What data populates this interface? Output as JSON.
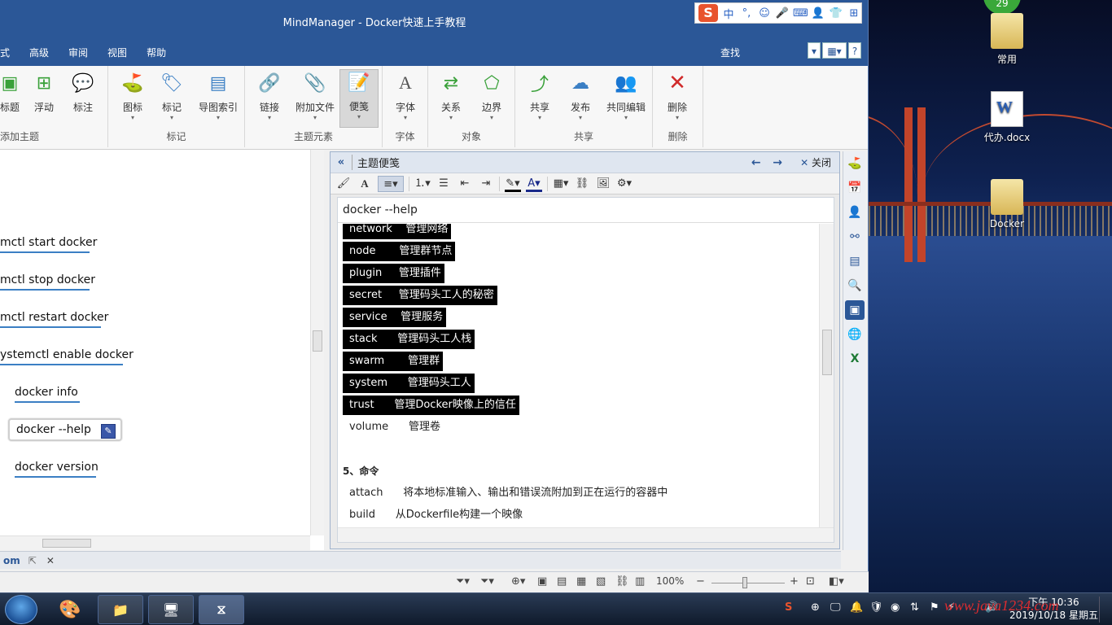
{
  "window": {
    "title": "MindManager - Docker快速上手教程"
  },
  "ime": {
    "items": [
      "中",
      "°,",
      "☺",
      "🎤",
      "⌨",
      "👤",
      "👕",
      "⊞"
    ]
  },
  "menu": {
    "items": [
      "式",
      "高级",
      "审阅",
      "视图",
      "帮助"
    ],
    "find": "查找"
  },
  "ribbon": {
    "groups": [
      {
        "title": "添加主题",
        "buttons": [
          {
            "label": "标题"
          },
          {
            "label": "浮动"
          },
          {
            "label": "标注"
          }
        ]
      },
      {
        "title": "标记",
        "buttons": [
          {
            "label": "图标"
          },
          {
            "label": "标记"
          },
          {
            "label": "导图索引"
          }
        ]
      },
      {
        "title": "主题元素",
        "buttons": [
          {
            "label": "链接"
          },
          {
            "label": "附加文件"
          },
          {
            "label": "便笺"
          }
        ]
      },
      {
        "title": "字体",
        "buttons": [
          {
            "label": "字体"
          }
        ]
      },
      {
        "title": "对象",
        "buttons": [
          {
            "label": "关系"
          },
          {
            "label": "边界"
          }
        ]
      },
      {
        "title": "共享",
        "buttons": [
          {
            "label": "共享"
          },
          {
            "label": "发布"
          },
          {
            "label": "共同编辑"
          }
        ]
      },
      {
        "title": "删除",
        "buttons": [
          {
            "label": "删除"
          }
        ]
      }
    ]
  },
  "map": {
    "nodes": [
      {
        "label": "mctl start docker"
      },
      {
        "label": "mctl stop docker"
      },
      {
        "label": "mctl restart docker"
      },
      {
        "label": "ystemctl enable docker"
      },
      {
        "label": "docker info"
      },
      {
        "label": "docker --help"
      },
      {
        "label": "docker version"
      }
    ]
  },
  "notes": {
    "panel_title": "主题便笺",
    "close_label": "关闭",
    "note_title": "docker --help",
    "lines": [
      {
        "text": "network    管理网络",
        "selected": true
      },
      {
        "text": "node       管理群节点",
        "selected": true
      },
      {
        "text": "plugin     管理插件",
        "selected": true
      },
      {
        "text": "secret     管理码头工人的秘密",
        "selected": true
      },
      {
        "text": "service    管理服务",
        "selected": true
      },
      {
        "text": "stack      管理码头工人栈",
        "selected": true
      },
      {
        "text": "swarm       管理群",
        "selected": true
      },
      {
        "text": "system      管理码头工人",
        "selected": true
      },
      {
        "text": "trust      管理Docker映像上的信任",
        "selected": true
      },
      {
        "text": "volume      管理卷",
        "selected": false
      },
      {
        "text": "",
        "selected": false
      },
      {
        "text": "5、命令",
        "selected": false,
        "heading": true
      },
      {
        "text": "attach      将本地标准输入、输出和错误流附加到正在运行的容器中",
        "selected": false
      },
      {
        "text": "build      从Dockerfile构建一个映像",
        "selected": false
      }
    ]
  },
  "doctabs": {
    "active": "om"
  },
  "status": {
    "zoom": "100%"
  },
  "desktop": {
    "badge": "29",
    "icons": [
      {
        "label": "常用"
      },
      {
        "label": "代办.docx"
      },
      {
        "label": "Docker"
      }
    ]
  },
  "taskbar": {
    "clock_time": "下午 10:36",
    "clock_date": "2019/10/18 星期五",
    "watermark": "www.java1234.com"
  }
}
